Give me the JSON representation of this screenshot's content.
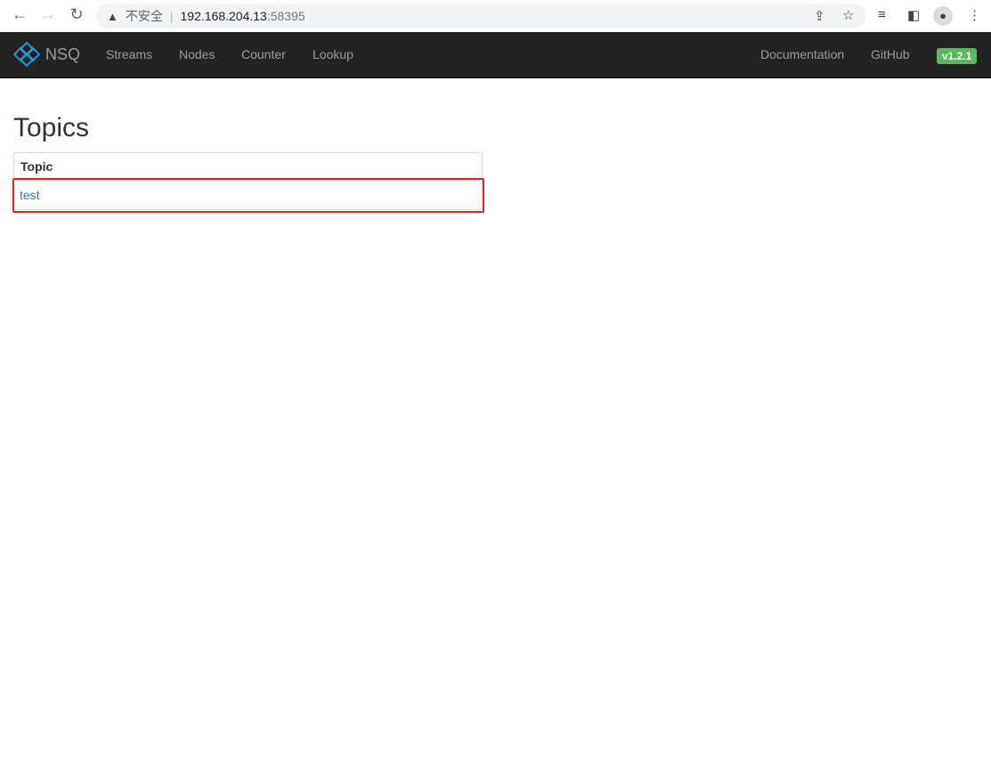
{
  "browser": {
    "security_label": "不安全",
    "url_host": "192.168.204.13",
    "url_port": ":58395"
  },
  "navbar": {
    "brand": "NSQ",
    "items": [
      "Streams",
      "Nodes",
      "Counter",
      "Lookup"
    ],
    "right_items": [
      "Documentation",
      "GitHub"
    ],
    "version": "v1.2.1",
    "version_color": "#5cb85c"
  },
  "page": {
    "title": "Topics",
    "table": {
      "header": "Topic",
      "rows": [
        "test"
      ]
    },
    "highlight_color": "#e8231f"
  }
}
